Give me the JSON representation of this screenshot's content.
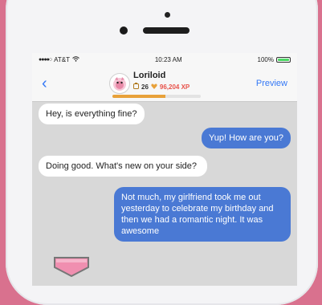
{
  "status_bar": {
    "carrier": "AT&T",
    "time": "10:23 AM",
    "battery_percent": "100%",
    "battery_level": 1.0
  },
  "nav": {
    "back_icon": "chevron-left-icon",
    "username": "Loriloid",
    "level": "26",
    "xp": "96,204 XP",
    "xp_progress": 0.6,
    "preview_label": "Preview"
  },
  "messages": [
    {
      "from": "them",
      "text": "Hey, is everything fine?"
    },
    {
      "from": "me",
      "text": "Yup! How are you?"
    },
    {
      "from": "them",
      "text": "Doing good. What's new on your side?"
    },
    {
      "from": "me",
      "text": "Not much, my girlfriend took me out yesterday to celebrate my birthday and then we had a romantic night. It was awesome"
    }
  ],
  "colors": {
    "background": "#d9718e",
    "outgoing_bubble": "#4a79d4",
    "incoming_bubble": "#ffffff",
    "link": "#3478f6",
    "xp": "#e8534b"
  }
}
